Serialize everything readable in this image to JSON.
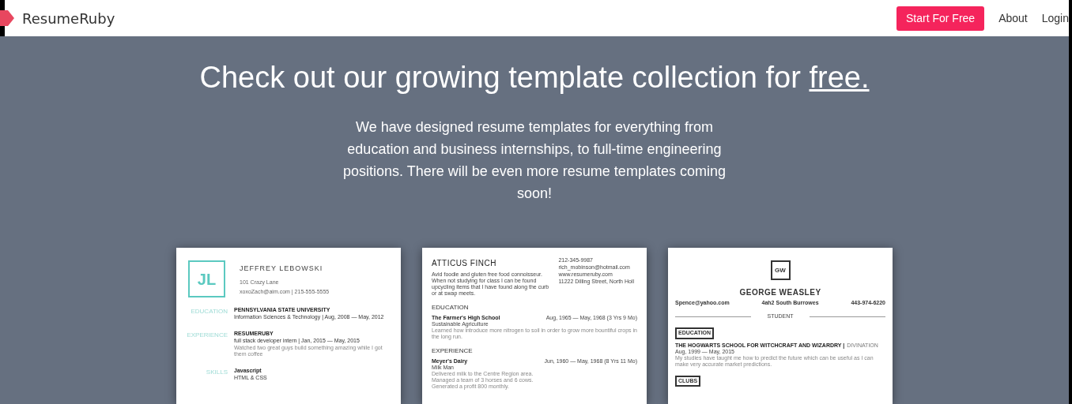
{
  "header": {
    "brand": "ResumeRuby",
    "cta": "Start For Free",
    "links": [
      "About",
      "Login"
    ]
  },
  "hero": {
    "title": "Check out our growing template collection for ",
    "title_link": "free.",
    "body": "We have designed resume templates for everything from education and business internships, to full-time engineering positions. There will be even more resume templates coming soon!"
  },
  "templates": [
    {
      "kind": "sidebar",
      "monogram": "JL",
      "name": "JEFFREY LEBOWSKI",
      "address": "101 Crazy Lane",
      "contact": "xoxoZach@aim.com | 215-555-5555",
      "sections": [
        {
          "label": "EDUCATION",
          "lines": [
            "PENNSYLVANIA STATE UNIVERSITY",
            "Information Sciences & Technology | Aug, 2008 — May, 2012"
          ]
        },
        {
          "label": "EXPERIENCE",
          "lines": [
            "RESUMERUBY",
            "full stack developer intern | Jan, 2015 — May, 2015",
            "Watched two great guys build something amazing while I got them coffee"
          ]
        },
        {
          "label": "SKILLS",
          "lines": [
            "Javascript",
            "HTML & CSS"
          ]
        }
      ]
    },
    {
      "kind": "classic",
      "name": "ATTICUS FINCH",
      "summary": "Avid foodie and gluten free food connoisseur. When not studying for class I can be found upcycling items that I have found along the curb or at swap meets.",
      "contacts": [
        "212-345-9987",
        "rich_mobinson@hotmail.com",
        "www.resumeruby.com",
        "11222 Dilling Street, North Holl"
      ],
      "sections": [
        {
          "label": "EDUCATION",
          "title": "The Farmer's High School",
          "date": "Aug, 1965 — May, 1968 (3 Yrs 9 Mo)",
          "subtitle": "Sustainable Agriculture",
          "details": [
            "Learned how introduce more nitrogen to soil in order to grow more bountiful crops in the long run."
          ]
        },
        {
          "label": "EXPERIENCE",
          "title": "Meyer's Dairy",
          "date": "Jun, 1960 — May, 1968 (8 Yrs 11 Mo)",
          "subtitle": "Milk Man",
          "details": [
            "Delivered milk to the Centre Region area.",
            "Managed a team of 3 horses and 6 cows.",
            "Generated a profit 800 monthly."
          ]
        }
      ]
    },
    {
      "kind": "centered",
      "monogram": "GW",
      "name": "GEORGE WEASLEY",
      "contacts": [
        "Spence@yahoo.com",
        "4ah2 South Burrowes",
        "443-974-6220"
      ],
      "role": "STUDENT",
      "sections": [
        {
          "label": "EDUCATION",
          "school": "THE HOGWARTS SCHOOL FOR WITCHCRAFT AND WIZARDRY |",
          "field": "DIVINATION",
          "date": "Aug, 1999 — May, 2015",
          "detail": "My studies have taught me how to predict the future which can be useful as I can make very accurate market predictions."
        },
        {
          "label": "CLUBS"
        }
      ]
    }
  ]
}
